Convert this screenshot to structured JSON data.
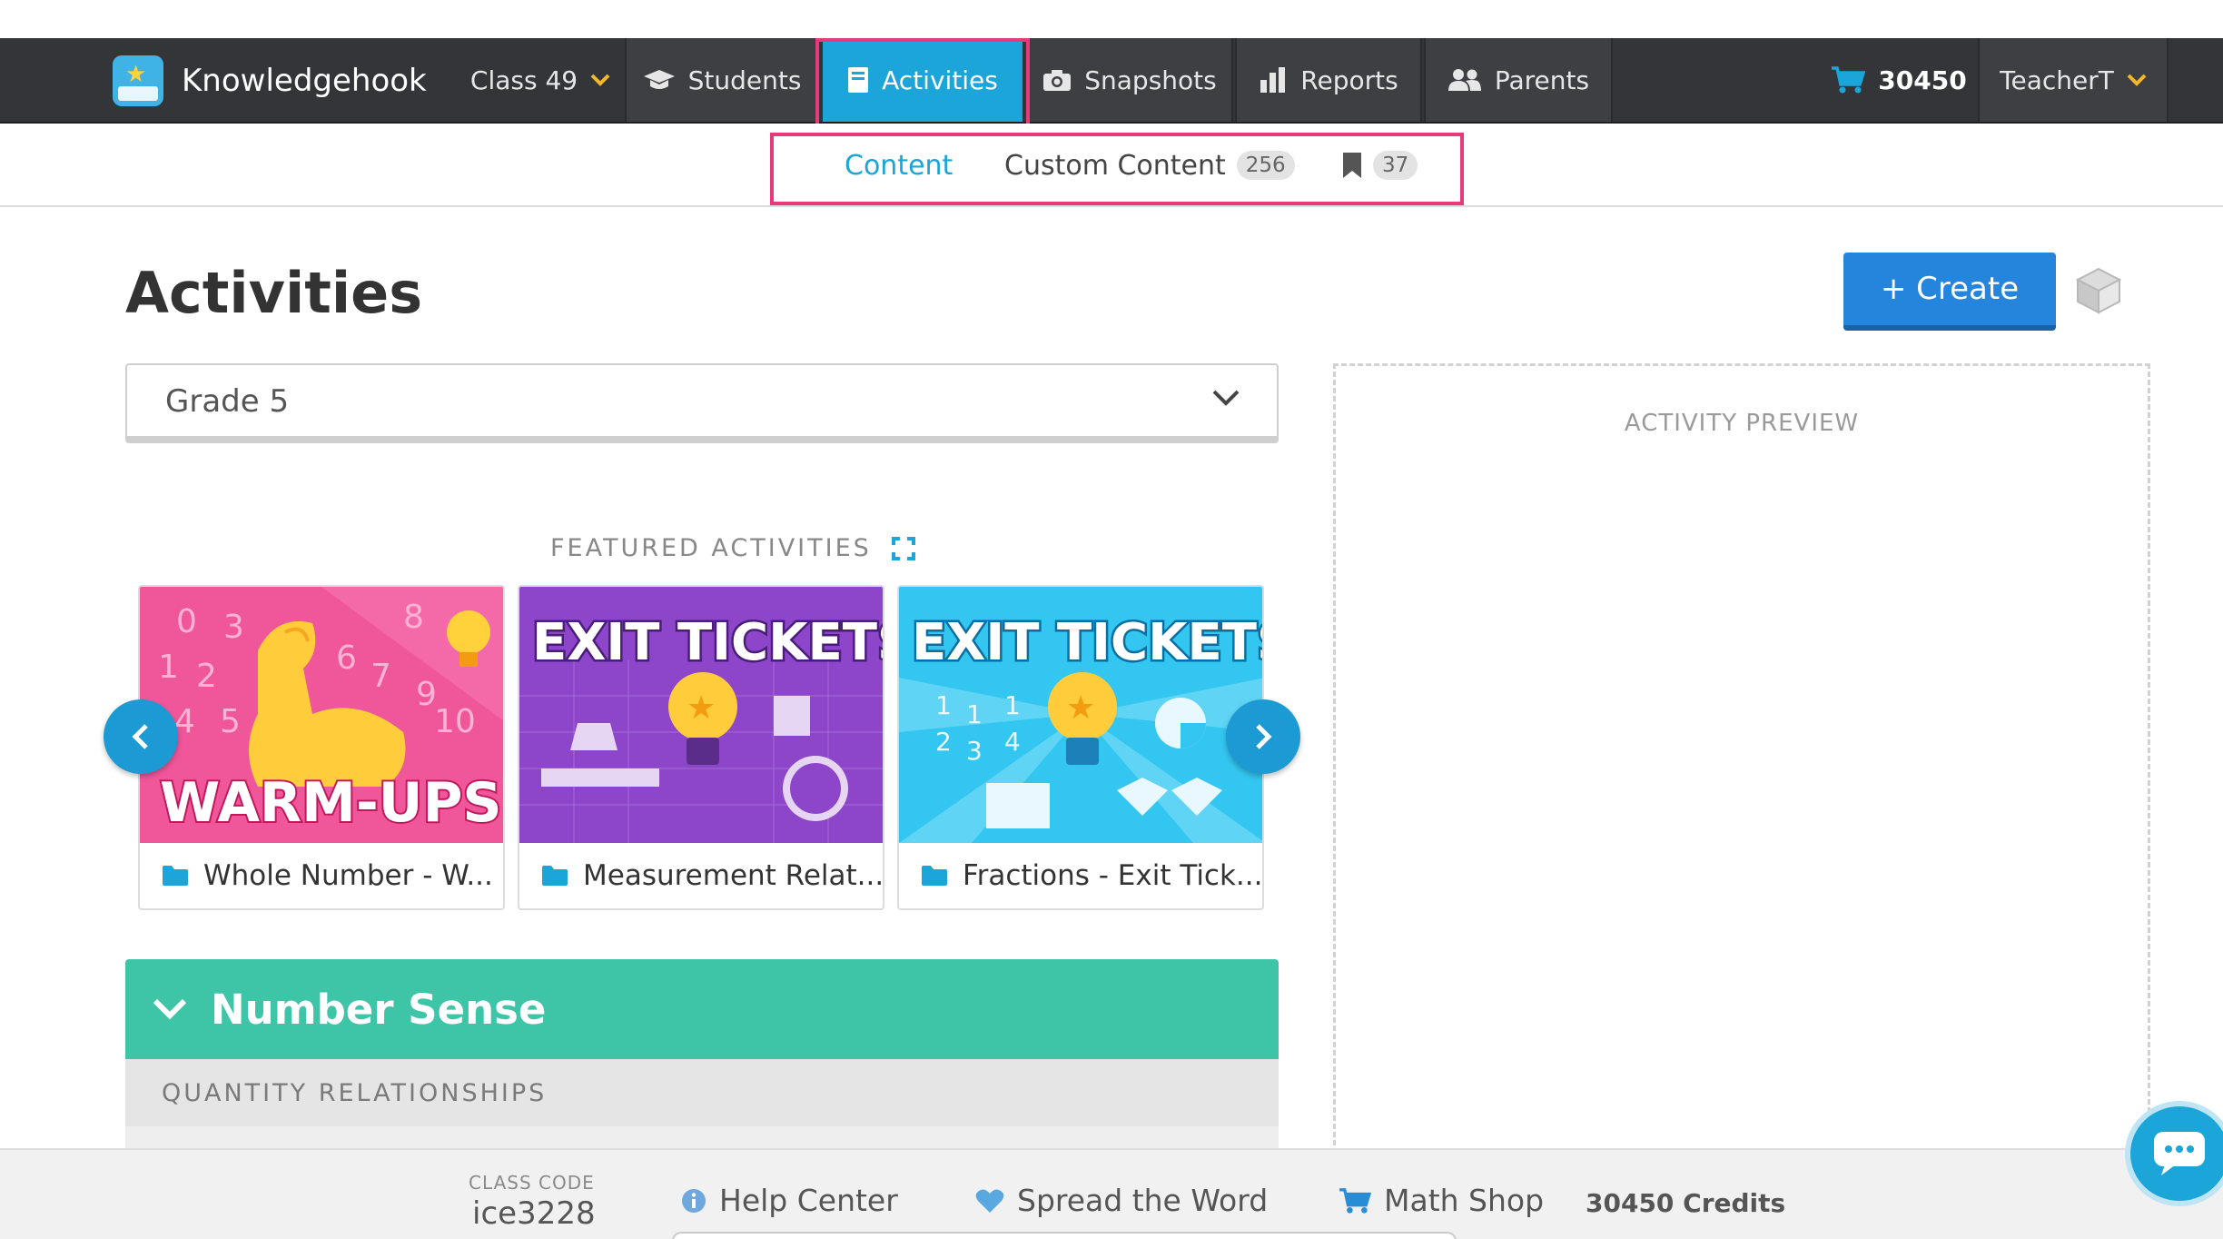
{
  "topnav": {
    "brand": "Knowledgehook",
    "class_selector": "Class 49",
    "items": [
      {
        "label": "Students",
        "icon": "graduation-cap-icon"
      },
      {
        "label": "Activities",
        "icon": "book-icon",
        "active": true
      },
      {
        "label": "Snapshots",
        "icon": "camera-icon"
      },
      {
        "label": "Reports",
        "icon": "bar-chart-icon"
      },
      {
        "label": "Parents",
        "icon": "users-icon"
      }
    ],
    "cart_count": "30450",
    "user": "TeacherT"
  },
  "subnav": {
    "content": "Content",
    "custom_content": "Custom Content",
    "custom_count": "256",
    "bookmark_count": "37"
  },
  "page": {
    "title": "Activities",
    "create_label": "+ Create",
    "grade": "Grade 5",
    "preview_label": "ACTIVITY PREVIEW",
    "featured_title": "FEATURED ACTIVITIES"
  },
  "cards": [
    {
      "caption": "Whole Number - W...",
      "art_text": "WARM-UPS"
    },
    {
      "caption": "Measurement Relat...",
      "art_text": "EXIT TICKETS"
    },
    {
      "caption": "Fractions - Exit Tick...",
      "art_text": "EXIT TICKETS"
    }
  ],
  "section": {
    "title": "Number Sense",
    "subsection": "QUANTITY RELATIONSHIPS"
  },
  "footer": {
    "class_code_label": "CLASS CODE",
    "class_code": "ice3228",
    "help": "Help Center",
    "spread": "Spread the Word",
    "shop": "Math Shop",
    "credits": "30450 Credits"
  },
  "colors": {
    "nav_bg": "#333538",
    "accent": "#1ba5d8",
    "highlight": "#e83a7a",
    "section_green": "#3ec4a7",
    "create_blue": "#2584dc"
  }
}
